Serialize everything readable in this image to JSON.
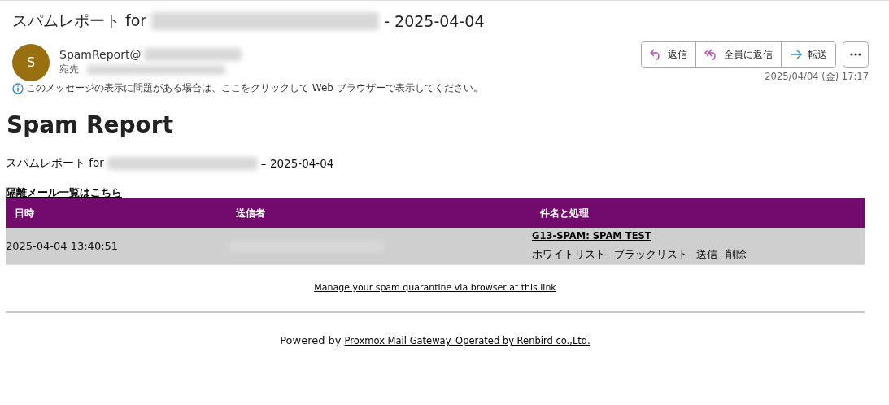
{
  "message": {
    "subject_prefix": "スパムレポート for",
    "subject_suffix": "- 2025-04-04",
    "avatar_letter": "S",
    "sender_prefix": "SpamReport@",
    "to_label": "宛先",
    "actions": [
      {
        "label": "返信",
        "kind": "reply"
      },
      {
        "label": "全員に返信",
        "kind": "reply-all"
      },
      {
        "label": "転送",
        "kind": "forward"
      }
    ],
    "date": "2025/04/04 (金) 17:17",
    "info": "このメッセージの表示に問題がある場合は、ここをクリックして Web ブラウザーで表示してください。"
  },
  "body": {
    "heading": "Spam Report",
    "subtitle_prefix": "スパムレポート for",
    "subtitle_suffix": "– 2025-04-04",
    "quarantine_link": "隔離メール一覧はこちら",
    "table": {
      "columns": [
        "日時",
        "送信者",
        "件名と処理"
      ],
      "rows": [
        {
          "datetime": "2025-04-04 13:40:51",
          "subject": "G13-SPAM: SPAM TEST",
          "actions": [
            "ホワイトリスト",
            "ブラックリスト",
            "送信",
            "削除"
          ]
        }
      ]
    },
    "manage_link": "Manage your spam quarantine via browser at this link",
    "footer_prefix": "Powered by",
    "footer_link": "Proxmox Mail Gateway. Operated by Renbird co.,Ltd."
  }
}
